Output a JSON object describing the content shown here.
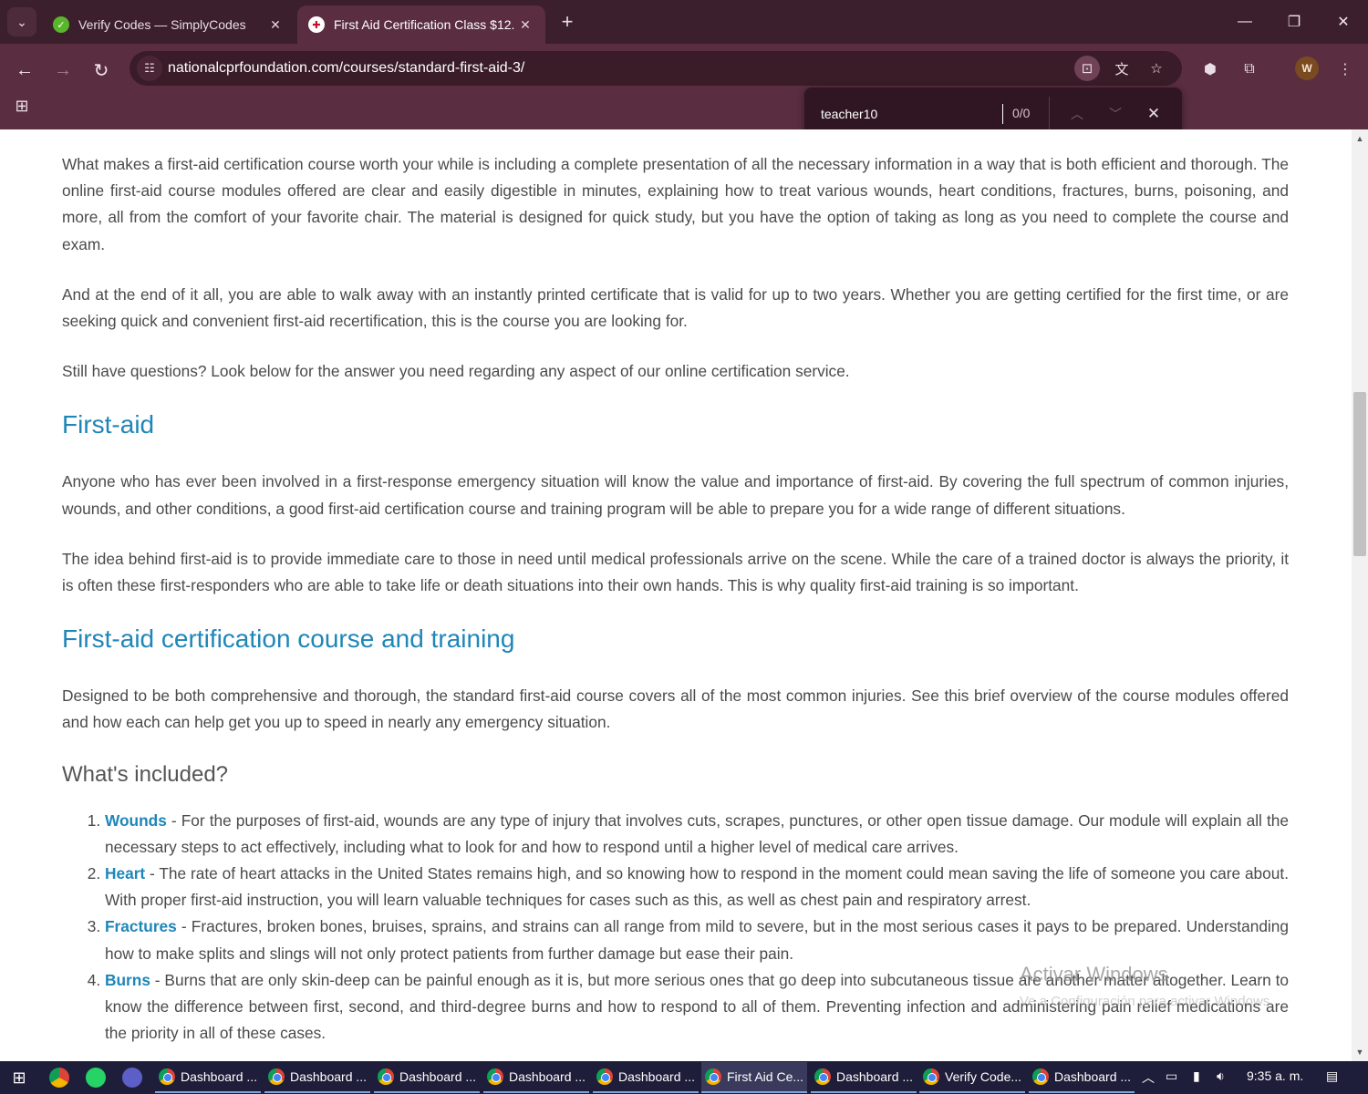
{
  "browser": {
    "tabs": [
      {
        "title": "Verify Codes — SimplyCodes",
        "active": false
      },
      {
        "title": "First Aid Certification Class $12.",
        "active": true
      }
    ],
    "new_tab": "+",
    "url": "nationalcprfoundation.com/courses/standard-first-aid-3/",
    "profile_initial": "W"
  },
  "find_bar": {
    "query": "teacher10",
    "count": "0/0"
  },
  "page": {
    "paragraphs_intro": [
      "What makes a first-aid certification course worth your while is including a complete presentation of all the necessary information in a way that is both efficient and thorough. The online first-aid course modules offered are clear and easily digestible in minutes, explaining how to treat various wounds, heart conditions, fractures, burns, poisoning, and more, all from the comfort of your favorite chair. The material is designed for quick study, but you have the option of taking as long as you need to complete the course and exam.",
      "And at the end of it all, you are able to walk away with an instantly printed certificate that is valid for up to two years. Whether you are getting certified for the first time, or are seeking quick and convenient first-aid recertification, this is the course you are looking for.",
      "Still have questions? Look below for the answer you need regarding any aspect of our online certification service."
    ],
    "heading_first_aid": "First-aid",
    "paragraphs_first_aid": [
      "Anyone who has ever been involved in a first-response emergency situation will know the value and importance of first-aid. By covering the full spectrum of common injuries, wounds, and other conditions, a good first-aid certification course and training program will be able to prepare you for a wide range of different situations.",
      "The idea behind first-aid is to provide immediate care to those in need until medical professionals arrive on the scene. While the care of a trained doctor is always the priority, it is often these first-responders who are able to take life or death situations into their own hands. This is why quality first-aid training is so important."
    ],
    "heading_course": "First-aid certification course and training",
    "paragraph_course": "Designed to be both comprehensive and thorough, the standard first-aid course covers all of the most common injuries. See this brief overview of the course modules offered and how each can help get you up to speed in nearly any emergency situation.",
    "heading_included": "What's included?",
    "modules": [
      {
        "term": "Wounds",
        "text": " - For the purposes of first-aid, wounds are any type of injury that involves cuts, scrapes, punctures, or other open tissue damage. Our module will explain all the necessary steps to act effectively, including what to look for and how to respond until a higher level of medical care arrives."
      },
      {
        "term": "Heart",
        "text": " - The rate of heart attacks in the United States remains high, and so knowing how to respond in the moment could mean saving the life of someone you care about. With proper first-aid instruction, you will learn valuable techniques for cases such as this, as well as chest pain and respiratory arrest."
      },
      {
        "term": "Fractures",
        "text": " - Fractures, broken bones, bruises, sprains, and strains can all range from mild to severe, but in the most serious cases it pays to be prepared. Understanding how to make splits and slings will not only protect patients from further damage but ease their pain."
      },
      {
        "term": "Burns",
        "text": " - Burns that are only skin-deep can be painful enough as it is, but more serious ones that go deep into subcutaneous tissue are another matter altogether. Learn to know the difference between first, second, and third-degree burns and how to respond to all of them. Preventing infection and administering pain relief medications are the priority in all of these cases."
      }
    ]
  },
  "watermark": {
    "title": "Activar Windows",
    "subtitle": "Ve a Configuración para activar Windows."
  },
  "taskbar": {
    "items": [
      {
        "label": "Dashboard ...",
        "active": false
      },
      {
        "label": "Dashboard ...",
        "active": false
      },
      {
        "label": "Dashboard ...",
        "active": false
      },
      {
        "label": "Dashboard ...",
        "active": false
      },
      {
        "label": "Dashboard ...",
        "active": false
      },
      {
        "label": "First Aid Ce...",
        "active": true
      },
      {
        "label": "Dashboard ...",
        "active": false
      },
      {
        "label": "Verify Code...",
        "active": false
      },
      {
        "label": "Dashboard ...",
        "active": false
      }
    ],
    "clock": "9:35 a. m."
  },
  "colors": {
    "chrome_dark": "#3b1f2c",
    "chrome_toolbar": "#5a2d41",
    "heading_blue": "#1f86b8",
    "body_text": "#4a4a4a",
    "taskbar": "#1e1e3a"
  }
}
